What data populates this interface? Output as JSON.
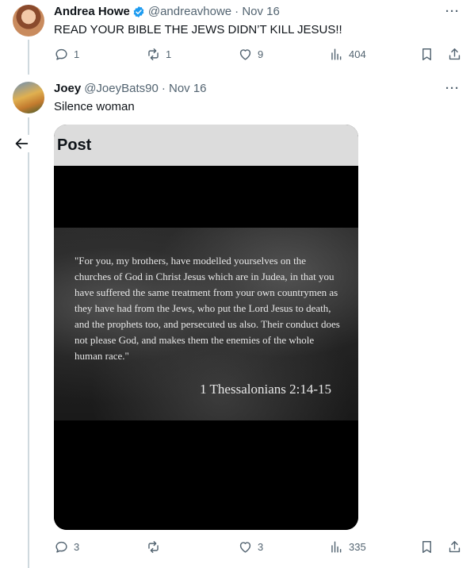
{
  "tweet1": {
    "name": "Andrea Howe",
    "handle": "@andreavhowe",
    "date": "· Nov 16",
    "text": "READ YOUR BIBLE THE JEWS DIDN’T KILL JESUS!!",
    "verified": true,
    "stats": {
      "replies": "1",
      "retweets": "1",
      "likes": "9",
      "views": "404"
    }
  },
  "tweet2": {
    "name": "Joey",
    "handle": "@JoeyBats90",
    "date": "· Nov 16",
    "text": "Silence woman",
    "embed": {
      "header": "Post",
      "quote": "\"For you, my brothers, have modelled yourselves on the churches of God in Christ Jesus which are in Judea, in that you have suffered the same treatment from your own countrymen as they have had from the Jews, who put the Lord Jesus to death, and the prophets too, and persecuted us also. Their conduct does not please God, and makes them the enemies of the whole human race.\"",
      "reference": "1 Thessalonians 2:14-15"
    },
    "stats": {
      "replies": "3",
      "retweets": "",
      "likes": "3",
      "views": "335"
    }
  },
  "colors": {
    "verified_blue": "#1d9bf0",
    "muted_gray": "#536471",
    "thread_line": "#cfd9de",
    "text": "#0f1419"
  },
  "icons": [
    "reply-icon",
    "retweet-icon",
    "like-icon",
    "views-icon",
    "bookmark-icon",
    "share-icon",
    "more-icon",
    "back-arrow-icon",
    "verified-badge-icon"
  ]
}
